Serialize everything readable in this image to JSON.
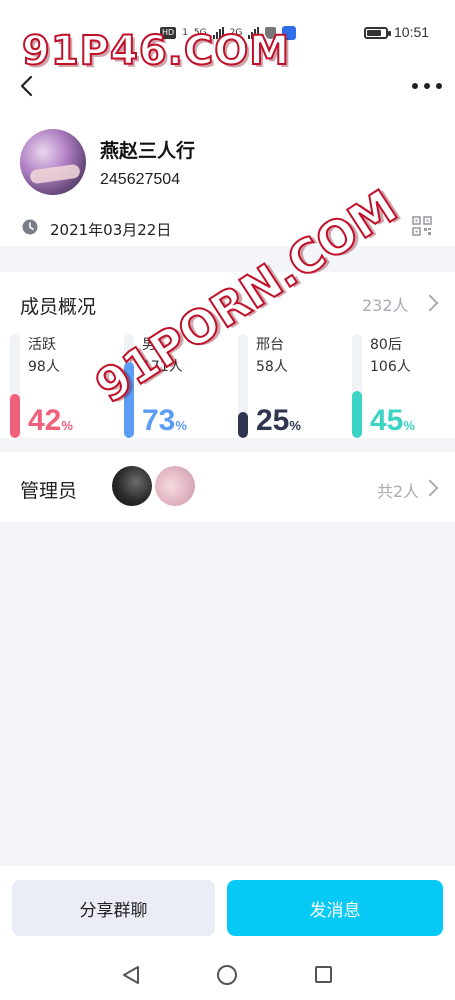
{
  "status_bar": {
    "time": "10:51",
    "indicators": [
      "HD",
      "1",
      "5G",
      "2G"
    ]
  },
  "header": {
    "back_icon": "chevron-left-icon",
    "more_icon": "more-dots-icon"
  },
  "group": {
    "name": "燕赵三人行",
    "id": "245627504",
    "created_date": "2021年03月22日"
  },
  "members": {
    "title": "成员概况",
    "total": "232人",
    "stats": [
      {
        "label": "活跃",
        "count": "98人",
        "percent_value": 42,
        "percent_sign": "%",
        "color": "#f0607a"
      },
      {
        "label": "男",
        "count": "171人",
        "percent_value": 73,
        "percent_sign": "%",
        "color": "#5b9df5"
      },
      {
        "label": "邢台",
        "count": "58人",
        "percent_value": 25,
        "percent_sign": "%",
        "color": "#2e3550"
      },
      {
        "label": "80后",
        "count": "106人",
        "percent_value": 45,
        "percent_sign": "%",
        "color": "#3ad3c4"
      }
    ]
  },
  "admins": {
    "title": "管理员",
    "count": "共2人"
  },
  "actions": {
    "share_label": "分享群聊",
    "message_label": "发消息"
  },
  "watermark": {
    "top": "91P46.COM",
    "diagonal": "91PORN.COM"
  },
  "colors": {
    "primary": "#06c9f5",
    "background": "#f4f5f9",
    "muted_text": "#a9acb3"
  }
}
